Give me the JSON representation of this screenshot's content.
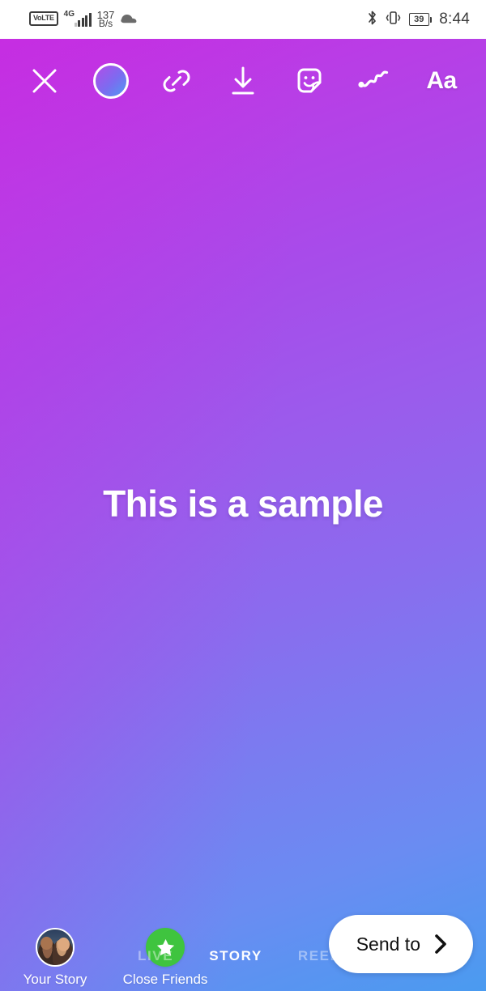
{
  "status_bar": {
    "volte_label": "VoLTE",
    "network_generation": "4G",
    "net_speed_value": "137",
    "net_speed_unit": "B/s",
    "cloud_icon": "cloud-icon",
    "bluetooth_icon": "bluetooth-icon",
    "vibrate_icon": "vibrate-icon",
    "battery_percent": "39",
    "time": "8:44"
  },
  "toolbar": {
    "close_label": "close-icon",
    "effects_label": "effects-circle-icon",
    "link_label": "link-icon",
    "save_label": "download-icon",
    "sticker_label": "sticker-icon",
    "draw_label": "draw-icon",
    "text_label": "Aa"
  },
  "story": {
    "text": "This is a sample"
  },
  "bottom": {
    "audiences": [
      {
        "label": "Your Story",
        "icon": "avatar"
      },
      {
        "label": "Close Friends",
        "icon": "close-friends-star"
      }
    ],
    "modes": [
      {
        "label": "LIVE",
        "active": false
      },
      {
        "label": "STORY",
        "active": true
      },
      {
        "label": "REELS",
        "active": false
      }
    ],
    "send_to_label": "Send to",
    "send_to_chevron": "chevron-right-icon"
  },
  "colors": {
    "gradient_start": "#c52fe2",
    "gradient_mid": "#9a5cec",
    "gradient_end": "#4a9bf0",
    "close_friends_green": "#3fc43f",
    "send_to_bg": "#ffffff",
    "text_white": "#ffffff"
  }
}
